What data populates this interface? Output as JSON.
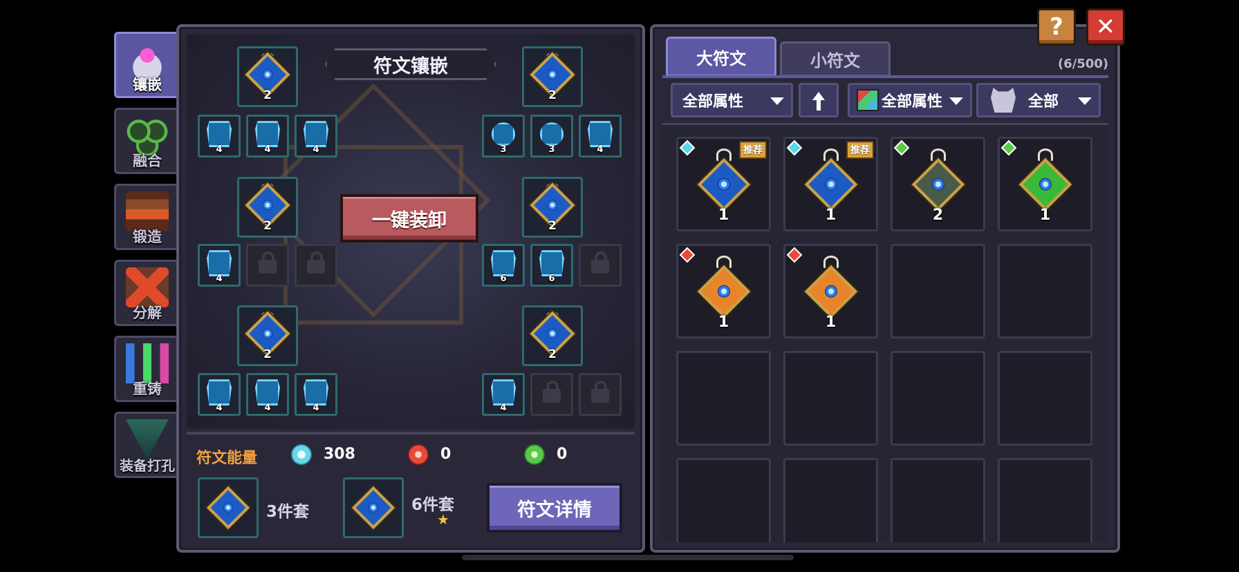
{
  "window": {
    "help_label": "?",
    "close_label": "✕"
  },
  "sidebar": {
    "items": [
      {
        "label": "镶嵌",
        "icon": "inlay-icon",
        "active": true
      },
      {
        "label": "融合",
        "icon": "fusion-icon",
        "active": false
      },
      {
        "label": "锻造",
        "icon": "forge-icon",
        "active": false
      },
      {
        "label": "分解",
        "icon": "dismantle-icon",
        "active": false
      },
      {
        "label": "重铸",
        "icon": "recast-icon",
        "active": false
      },
      {
        "label": "装备打孔",
        "icon": "socket-punch-icon",
        "active": false
      }
    ]
  },
  "inlay": {
    "title": "符文镶嵌",
    "unequip_all_label": "一键装卸",
    "big_runes": [
      {
        "level": "2"
      },
      {
        "level": "2"
      },
      {
        "level": "2"
      },
      {
        "level": "2"
      },
      {
        "level": "2"
      },
      {
        "level": "2"
      }
    ],
    "small_runes": {
      "top_left": [
        "4",
        "4",
        "4"
      ],
      "top_right": [
        "3",
        "3",
        "4"
      ],
      "mid_left": [
        "4",
        "locked",
        "locked"
      ],
      "mid_right": [
        "6",
        "6",
        "locked"
      ],
      "bottom_left": [
        "4",
        "4",
        "4"
      ],
      "bottom_right": [
        "4",
        "locked",
        "locked"
      ]
    },
    "energy": {
      "label": "符文能量",
      "blue": "308",
      "red": "0",
      "green": "0"
    },
    "sets": [
      {
        "label": "3件套"
      },
      {
        "label": "6件套",
        "star": "★"
      }
    ],
    "detail_button_label": "符文详情"
  },
  "inventory": {
    "tabs": [
      {
        "label": "大符文",
        "active": true
      },
      {
        "label": "小符文",
        "active": false
      }
    ],
    "count": "(6/500)",
    "filters": {
      "attribute": "全部属性",
      "color_attribute": "全部属性",
      "monster": "全部"
    },
    "badge_label": "推荐",
    "items": [
      {
        "level": "1",
        "element": "blue",
        "recommended": true
      },
      {
        "level": "1",
        "element": "blue",
        "recommended": true
      },
      {
        "level": "2",
        "element": "green",
        "recommended": false
      },
      {
        "level": "1",
        "element": "green",
        "recommended": false
      },
      {
        "level": "1",
        "element": "red",
        "recommended": false
      },
      {
        "level": "1",
        "element": "red",
        "recommended": false
      }
    ]
  },
  "colors": {
    "accent_purple": "#6e66b8",
    "unequip_red": "#b95a5e",
    "energy_orange": "#f2a23c",
    "rune_blue": "#1c5bc4",
    "rune_gold": "#c9a24a"
  }
}
